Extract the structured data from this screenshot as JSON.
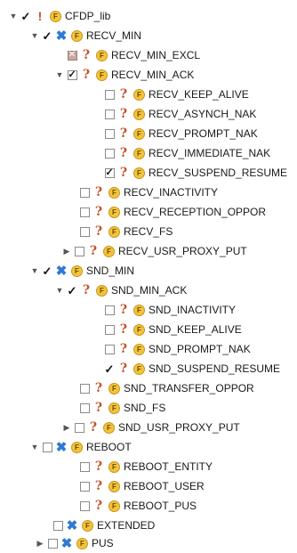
{
  "tree": {
    "root": {
      "label": "CFDP_lib"
    },
    "recv_min": {
      "label": "RECV_MIN"
    },
    "recv_min_excl": {
      "label": "RECV_MIN_EXCL"
    },
    "recv_min_ack": {
      "label": "RECV_MIN_ACK"
    },
    "recv_keep_alive": {
      "label": "RECV_KEEP_ALIVE"
    },
    "recv_asynch_nak": {
      "label": "RECV_ASYNCH_NAK"
    },
    "recv_prompt_nak": {
      "label": "RECV_PROMPT_NAK"
    },
    "recv_immediate_nak": {
      "label": "RECV_IMMEDIATE_NAK"
    },
    "recv_suspend_resume": {
      "label": "RECV_SUSPEND_RESUME"
    },
    "recv_inactivity": {
      "label": "RECV_INACTIVITY"
    },
    "recv_reception_oppor": {
      "label": "RECV_RECEPTION_OPPOR"
    },
    "recv_fs": {
      "label": "RECV_FS"
    },
    "recv_usr_proxy_put": {
      "label": "RECV_USR_PROXY_PUT"
    },
    "snd_min": {
      "label": "SND_MIN"
    },
    "snd_min_ack": {
      "label": "SND_MIN_ACK"
    },
    "snd_inactivity": {
      "label": "SND_INACTIVITY"
    },
    "snd_keep_alive": {
      "label": "SND_KEEP_ALIVE"
    },
    "snd_prompt_nak": {
      "label": "SND_PROMPT_NAK"
    },
    "snd_suspend_resume": {
      "label": "SND_SUSPEND_RESUME"
    },
    "snd_transfer_oppor": {
      "label": "SND_TRANSFER_OPPOR"
    },
    "snd_fs": {
      "label": "SND_FS"
    },
    "snd_usr_proxy_put": {
      "label": "SND_USR_PROXY_PUT"
    },
    "reboot": {
      "label": "REBOOT"
    },
    "reboot_entity": {
      "label": "REBOOT_ENTITY"
    },
    "reboot_user": {
      "label": "REBOOT_USER"
    },
    "reboot_pus": {
      "label": "REBOOT_PUS"
    },
    "extended": {
      "label": "EXTENDED"
    },
    "pus": {
      "label": "PUS"
    }
  },
  "icons": {
    "disclosure_expanded": "triangle-down-icon",
    "disclosure_collapsed": "triangle-right-icon",
    "alternative_group": "x-icon",
    "optional_feature": "question-icon",
    "mandatory_root": "exclamation-icon",
    "feature": "feature-f-icon",
    "excluded": "excluded-checkbox"
  },
  "colors": {
    "feature_icon": "#f3c43a",
    "question_icon": "#c8502a",
    "group_icon": "#2e7ad1"
  }
}
